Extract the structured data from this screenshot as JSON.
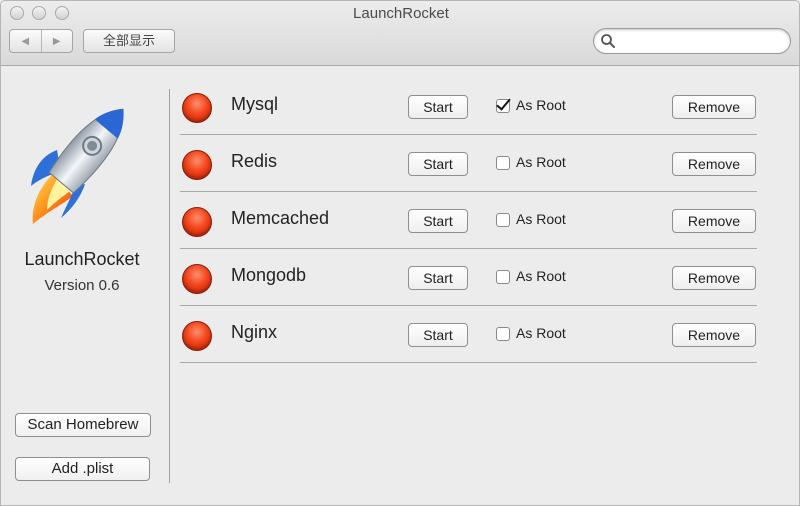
{
  "window": {
    "title": "LaunchRocket",
    "toolbar": {
      "show_all_label": "全部显示",
      "back_icon": "◀",
      "forward_icon": "▶"
    },
    "search": {
      "value": "",
      "placeholder": ""
    }
  },
  "sidebar": {
    "app_name": "LaunchRocket",
    "version": "Version 0.6",
    "scan_label": "Scan Homebrew",
    "add_label": "Add .plist"
  },
  "services": [
    {
      "name": "Mysql",
      "start_label": "Start",
      "as_root_label": "As Root",
      "as_root": true,
      "remove_label": "Remove",
      "status_color": "#e8401a"
    },
    {
      "name": "Redis",
      "start_label": "Start",
      "as_root_label": "As Root",
      "as_root": false,
      "remove_label": "Remove",
      "status_color": "#e8401a"
    },
    {
      "name": "Memcached",
      "start_label": "Start",
      "as_root_label": "As Root",
      "as_root": false,
      "remove_label": "Remove",
      "status_color": "#e8401a"
    },
    {
      "name": "Mongodb",
      "start_label": "Start",
      "as_root_label": "As Root",
      "as_root": false,
      "remove_label": "Remove",
      "status_color": "#e8401a"
    },
    {
      "name": "Nginx",
      "start_label": "Start",
      "as_root_label": "As Root",
      "as_root": false,
      "remove_label": "Remove",
      "status_color": "#e8401a"
    }
  ]
}
